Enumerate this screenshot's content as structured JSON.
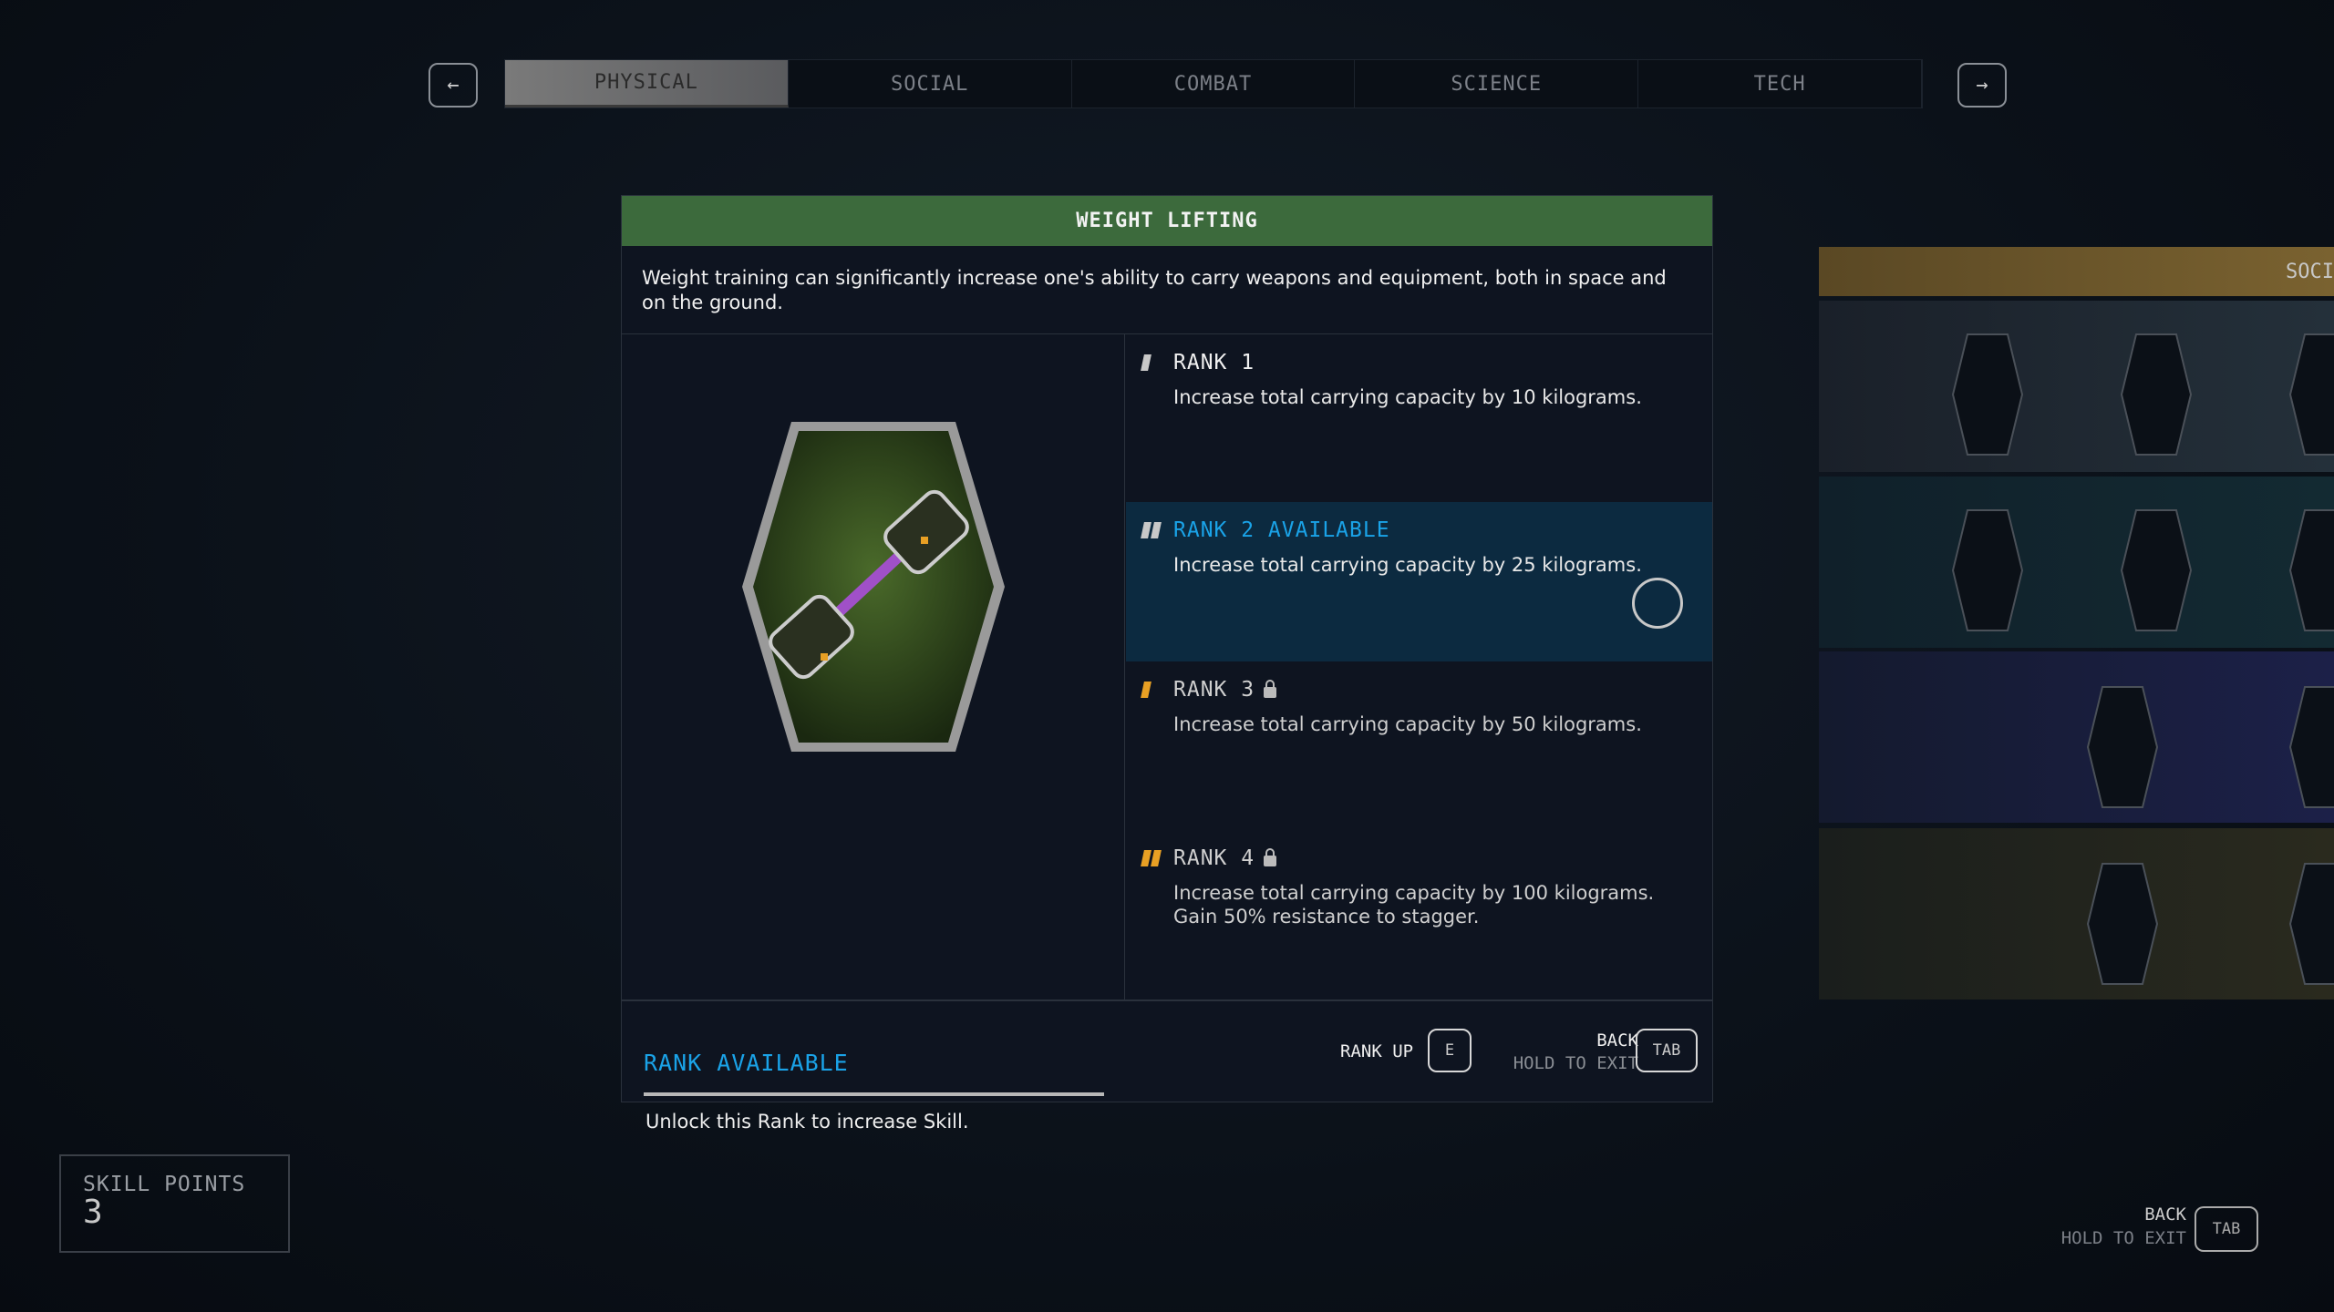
{
  "nav": {
    "prev_icon": "arrow-left-icon",
    "next_icon": "arrow-right-icon",
    "prev_glyph": "←",
    "next_glyph": "→"
  },
  "tabs": [
    {
      "label": "PHYSICAL",
      "active": true
    },
    {
      "label": "SOCIAL"
    },
    {
      "label": "COMBAT"
    },
    {
      "label": "SCIENCE"
    },
    {
      "label": "TECH"
    }
  ],
  "skill": {
    "title": "WEIGHT LIFTING",
    "description": "Weight training can significantly increase one's ability to carry weapons and equipment, both in space and on the ground.",
    "status": "RANK AVAILABLE",
    "status_hint": "Unlock this Rank to increase Skill.",
    "header_color": "#3c6a3c",
    "ranks": [
      {
        "title": "RANK 1",
        "text": "Increase total carrying capacity by 10 kilograms.",
        "locked": false
      },
      {
        "title": "RANK 2 AVAILABLE",
        "text": "Increase total carrying capacity by 25 kilograms.",
        "locked": false,
        "selected": true
      },
      {
        "title": "RANK 3",
        "text": "Increase total carrying capacity by 50 kilograms.",
        "locked": true
      },
      {
        "title": "RANK 4",
        "text": "Increase total carrying capacity by 100 kilograms.",
        "text2": "Gain 50% resistance to stagger.",
        "locked": true
      }
    ]
  },
  "footer": {
    "rank_up_label": "RANK UP",
    "rank_up_key": "E",
    "back_label": "BACK",
    "hold_label": "HOLD TO EXIT",
    "back_key": "TAB"
  },
  "side_panel": {
    "title": "SOCI",
    "header_color": "#6e5a2a"
  },
  "skill_points": {
    "label": "SKILL POINTS",
    "value": "3"
  },
  "global_footer": {
    "back_label": "BACK",
    "hold_label": "HOLD TO EXIT",
    "back_key": "TAB"
  },
  "colors": {
    "accent": "#1aa3e8",
    "locked": "#e8a024",
    "selected_bg": "#0c2a40"
  }
}
